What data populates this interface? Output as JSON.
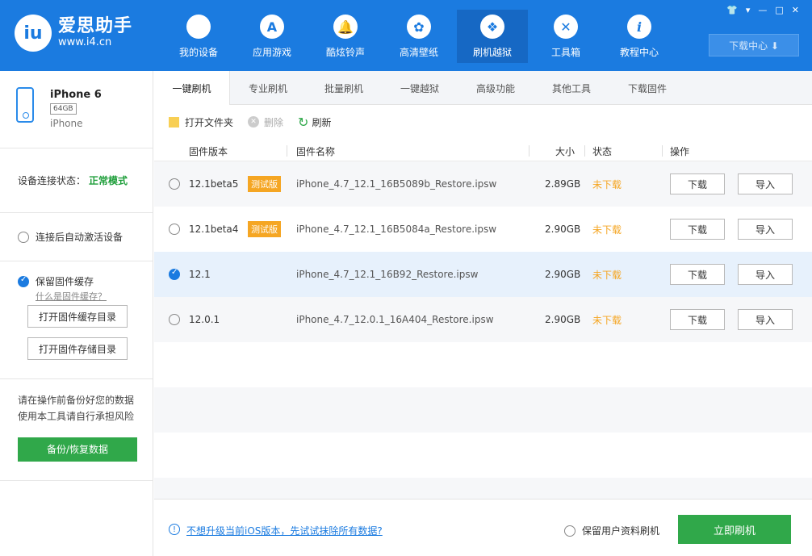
{
  "app": {
    "logo_mark": "iu",
    "name": "爱思助手",
    "url": "www.i4.cn"
  },
  "nav": [
    {
      "label": "我的设备",
      "icon": "apple-icon",
      "glyph": ""
    },
    {
      "label": "应用游戏",
      "icon": "app-store-icon",
      "glyph": "A"
    },
    {
      "label": "酷炫铃声",
      "icon": "bell-icon",
      "glyph": "🔔"
    },
    {
      "label": "高清壁纸",
      "icon": "flower-icon",
      "glyph": "✿"
    },
    {
      "label": "刷机越狱",
      "icon": "dropbox-icon",
      "glyph": "❖"
    },
    {
      "label": "工具箱",
      "icon": "tools-icon",
      "glyph": "✕"
    },
    {
      "label": "教程中心",
      "icon": "info-icon",
      "glyph": "i"
    }
  ],
  "window_controls": [
    "👕",
    "▾",
    "—",
    "□",
    "✕"
  ],
  "download_center": "下载中心 ⬇",
  "device": {
    "name": "iPhone 6",
    "capacity": "64GB",
    "type": "iPhone"
  },
  "connection": {
    "label": "设备连接状态：",
    "mode": "正常模式"
  },
  "auto_activate": "连接后自动激活设备",
  "cache": {
    "keep_label": "保留固件缓存",
    "what_link": "什么是固件缓存？",
    "open_cache_dir": "打开固件缓存目录",
    "open_store_dir": "打开固件存储目录"
  },
  "warning": {
    "line1": "请在操作前备份好您的数据",
    "line2": "使用本工具请自行承担风险",
    "backup_btn": "备份/恢复数据"
  },
  "tabs": [
    "一键刷机",
    "专业刷机",
    "批量刷机",
    "一键越狱",
    "高级功能",
    "其他工具",
    "下载固件"
  ],
  "toolbar": {
    "open_folder": "打开文件夹",
    "delete": "删除",
    "refresh": "刷新"
  },
  "table": {
    "headers": {
      "version": "固件版本",
      "name": "固件名称",
      "size": "大小",
      "status": "状态",
      "action": "操作"
    },
    "rows": [
      {
        "version": "12.1beta5",
        "badge": "测试版",
        "name": "iPhone_4.7_12.1_16B5089b_Restore.ipsw",
        "size": "2.89GB",
        "status": "未下载",
        "selected": false
      },
      {
        "version": "12.1beta4",
        "badge": "测试版",
        "name": "iPhone_4.7_12.1_16B5084a_Restore.ipsw",
        "size": "2.90GB",
        "status": "未下载",
        "selected": false
      },
      {
        "version": "12.1",
        "badge": "",
        "name": "iPhone_4.7_12.1_16B92_Restore.ipsw",
        "size": "2.90GB",
        "status": "未下载",
        "selected": true
      },
      {
        "version": "12.0.1",
        "badge": "",
        "name": "iPhone_4.7_12.0.1_16A404_Restore.ipsw",
        "size": "2.90GB",
        "status": "未下载",
        "selected": false
      }
    ],
    "download_btn": "下载",
    "import_btn": "导入"
  },
  "footer": {
    "info_link": "不想升级当前iOS版本，先试试抹除所有数据?",
    "keep_user_data": "保留用户资料刷机",
    "flash_btn": "立即刷机"
  },
  "colors": {
    "brand_blue": "#1b7be0",
    "green": "#30a84a",
    "orange": "#f5a623"
  }
}
